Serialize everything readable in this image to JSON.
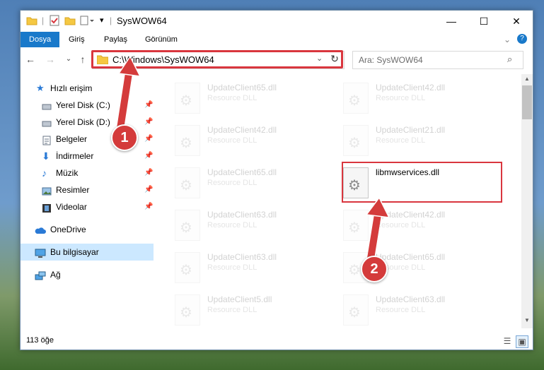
{
  "window": {
    "title": "SysWOW64"
  },
  "ribbon": {
    "tabs": [
      "Dosya",
      "Giriş",
      "Paylaş",
      "Görünüm"
    ]
  },
  "nav": {
    "address": "C:\\Windows\\SysWOW64",
    "search_placeholder": "Ara: SysWOW64"
  },
  "sidebar": {
    "items": [
      {
        "label": "Hızlı erişim",
        "icon": "star-icon"
      },
      {
        "label": "Yerel Disk (C:)",
        "icon": "drive-icon",
        "pinned": true
      },
      {
        "label": "Yerel Disk (D:)",
        "icon": "drive-icon",
        "pinned": true
      },
      {
        "label": "Belgeler",
        "icon": "documents-icon",
        "pinned": true
      },
      {
        "label": "İndirmeler",
        "icon": "download-icon",
        "pinned": true
      },
      {
        "label": "Müzik",
        "icon": "music-icon",
        "pinned": true
      },
      {
        "label": "Resimler",
        "icon": "pictures-icon",
        "pinned": true
      },
      {
        "label": "Videolar",
        "icon": "videos-icon",
        "pinned": true
      },
      {
        "label": "OneDrive",
        "icon": "cloud-icon"
      },
      {
        "label": "Bu bilgisayar",
        "icon": "computer-icon",
        "selected": true
      },
      {
        "label": "Ağ",
        "icon": "network-icon"
      }
    ]
  },
  "files": [
    {
      "name": "UpdateClient65.dll",
      "type": "Resource DLL",
      "faded": true
    },
    {
      "name": "UpdateClient42.dll",
      "type": "Resource DLL",
      "faded": true
    },
    {
      "name": "UpdateClient42.dll",
      "type": "Resource DLL",
      "faded": true
    },
    {
      "name": "UpdateClient21.dll",
      "type": "Resource DLL",
      "faded": true
    },
    {
      "name": "UpdateClient65.dll",
      "type": "Resource DLL",
      "faded": true
    },
    {
      "name": "libmwservices.dll",
      "type": "",
      "faded": false
    },
    {
      "name": "UpdateClient63.dll",
      "type": "Resource DLL",
      "faded": true
    },
    {
      "name": "UpdateClient42.dll",
      "type": "Resource DLL",
      "faded": true
    },
    {
      "name": "UpdateClient63.dll",
      "type": "Resource DLL",
      "faded": true
    },
    {
      "name": "UpdateClient65.dll",
      "type": "Resource DLL",
      "faded": true
    },
    {
      "name": "UpdateClient5.dll",
      "type": "Resource DLL",
      "faded": true
    },
    {
      "name": "UpdateClient63.dll",
      "type": "Resource DLL",
      "faded": true
    }
  ],
  "status": {
    "count": "113 öğe"
  },
  "callouts": {
    "one": "1",
    "two": "2"
  },
  "colors": {
    "accent": "#1979ca",
    "highlight": "#d9363e",
    "selected": "#cce8ff"
  }
}
